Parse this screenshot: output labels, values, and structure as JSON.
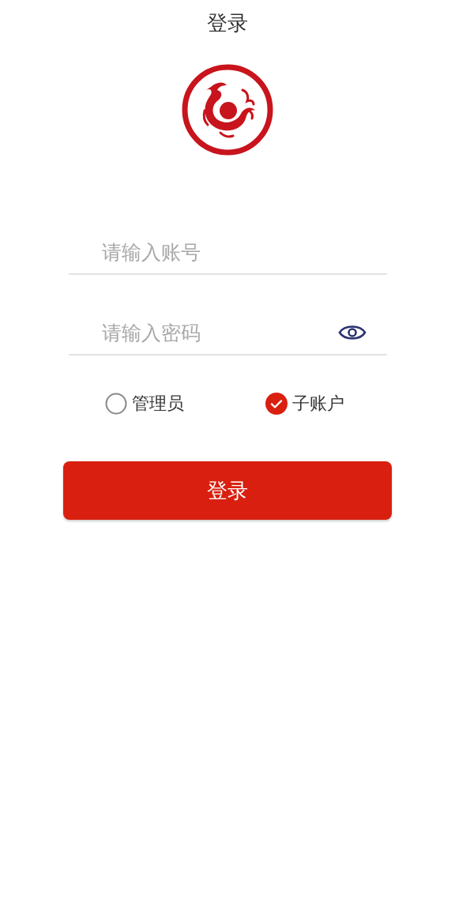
{
  "header": {
    "title": "登录"
  },
  "form": {
    "account": {
      "placeholder": "请输入账号"
    },
    "password": {
      "placeholder": "请输入密码"
    }
  },
  "roles": [
    {
      "label": "管理员",
      "selected": false
    },
    {
      "label": "子账户",
      "selected": true
    }
  ],
  "submit": {
    "label": "登录"
  }
}
